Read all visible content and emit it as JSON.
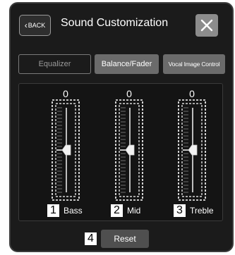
{
  "header": {
    "back_label": "BACK",
    "title": "Sound Customization"
  },
  "tabs": [
    {
      "label": "Equalizer",
      "selected": true
    },
    {
      "label": "Balance/Fader",
      "selected": false
    },
    {
      "label": "Vocal Image Control",
      "selected": false
    }
  ],
  "channels": [
    {
      "number": "1",
      "label": "Bass",
      "value": "0",
      "level": 0.5
    },
    {
      "number": "2",
      "label": "Mid",
      "value": "0",
      "level": 0.5
    },
    {
      "number": "3",
      "label": "Treble",
      "value": "0",
      "level": 0.5
    }
  ],
  "reset": {
    "number": "4",
    "label": "Reset"
  },
  "icons": {
    "back": "chevron-left-icon",
    "close": "close-icon"
  },
  "colors": {
    "background": "#1b1b1b",
    "button": "#6b6b6b",
    "close": "#8c8c8c"
  }
}
